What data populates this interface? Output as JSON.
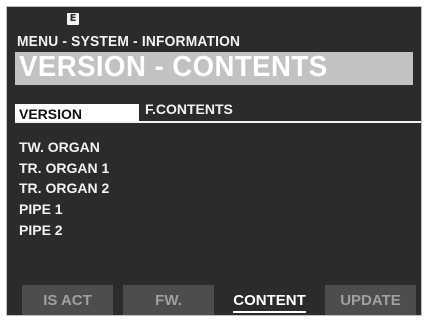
{
  "header": {
    "indicator": "E",
    "menu_path": "MENU - SYSTEM - INFORMATION",
    "title": "VERSION - CONTENTS"
  },
  "subtabs": {
    "active_label": "VERSION",
    "inactive_label": "F.CONTENTS"
  },
  "contents": {
    "items": [
      "TW. ORGAN",
      "TR. ORGAN 1",
      "TR. ORGAN 2",
      "PIPE 1",
      "PIPE 2"
    ]
  },
  "bottom_tabs": {
    "items": [
      {
        "label": "IS ACT",
        "active": false
      },
      {
        "label": "FW.",
        "active": false
      },
      {
        "label": "CONTENT",
        "active": true
      },
      {
        "label": "UPDATE",
        "active": false
      }
    ]
  },
  "colors": {
    "screen_bg": "#2b2b2b",
    "title_bar": "#c2c2c2",
    "tab_inactive_bg": "#4d4d4d",
    "text": "#f2f2f2"
  }
}
